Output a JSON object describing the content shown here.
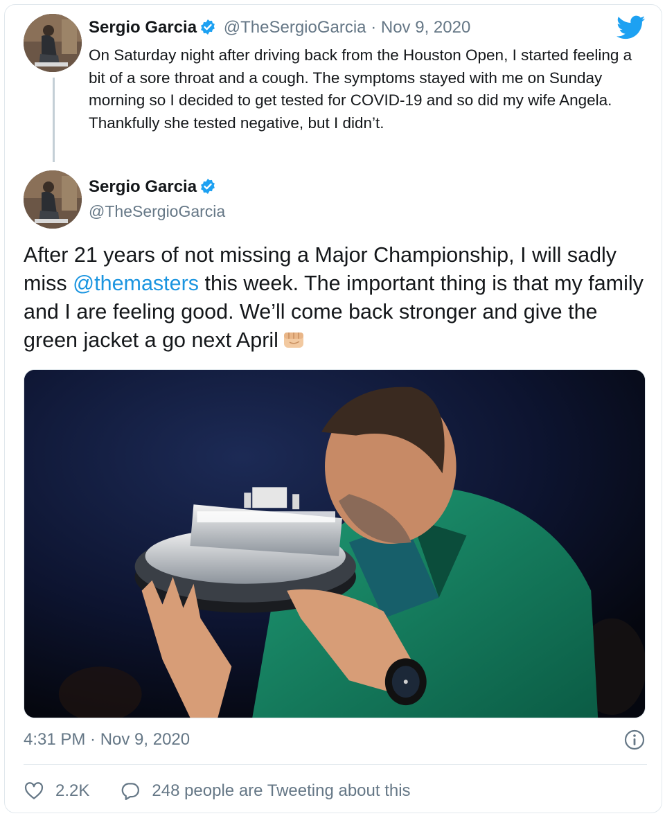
{
  "reply_tweet": {
    "name": "Sergio Garcia",
    "handle": "@TheSergioGarcia",
    "separator": "·",
    "date": "Nov 9, 2020",
    "text": "On Saturday night after driving back from the Houston Open, I started feeling a bit of a sore throat and a cough. The symptoms stayed with me on Sunday morning so I decided to get tested for COVID-19 and so did my wife Angela. Thankfully she tested negative, but I didn’t."
  },
  "main_tweet": {
    "name": "Sergio Garcia",
    "handle": "@TheSergioGarcia",
    "text_before": "After 21 years of not missing a Major Championship, I will sadly miss ",
    "mention": "@themasters",
    "text_after": " this week. The important thing is that my family and I are feeling good. We’ll come back stronger and give the green jacket a go next April",
    "emoji": "oncoming-fist-emoji",
    "timestamp": "4:31 PM · Nov 9, 2020",
    "likes": "2.2K",
    "conversation": "248 people are Tweeting about this"
  },
  "icons": {
    "brand": "twitter-bird-icon",
    "verified": "verified-badge-icon",
    "info": "info-icon",
    "like": "heart-icon",
    "reply": "speech-bubble-icon"
  },
  "colors": {
    "brand_blue": "#1da1f2",
    "mention_blue": "#1b95e0",
    "secondary_text": "#657786",
    "primary_text": "#14171a",
    "border": "#e1e8ed"
  }
}
